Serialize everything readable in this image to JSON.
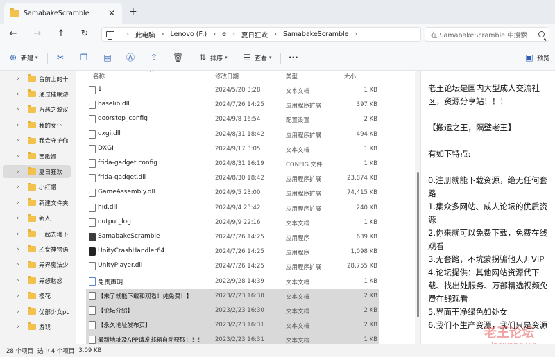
{
  "window": {
    "tab_title": "SamabakeScramble",
    "tab_close": "✕",
    "tab_add": "+"
  },
  "nav": {
    "back": "←",
    "forward": "→",
    "up": "↑",
    "refresh": "↻"
  },
  "breadcrumb": [
    "此电脑",
    "Lenovo (F:)",
    "e",
    "夏日狂欢",
    "SamabakeScramble"
  ],
  "search": {
    "placeholder": "在 SamabakeScramble 中搜索"
  },
  "toolbar": {
    "new_label": "新建",
    "sort_label": "排序",
    "view_label": "查看",
    "more_label": "···",
    "preview_label": "预览"
  },
  "sidebar": {
    "items": [
      {
        "label": "台前上的十"
      },
      {
        "label": "通过催眠游"
      },
      {
        "label": "万恶之源汉"
      },
      {
        "label": "我的女仆"
      },
      {
        "label": "我会守护你"
      },
      {
        "label": "西歌娜"
      },
      {
        "label": "夏日狂欢",
        "selected": true
      },
      {
        "label": "小红帽"
      },
      {
        "label": "新建文件夹"
      },
      {
        "label": "新人"
      },
      {
        "label": "一起去地下"
      },
      {
        "label": "乙女神物语"
      },
      {
        "label": "异界魔法少"
      },
      {
        "label": "异想魅惑"
      },
      {
        "label": "樱花"
      },
      {
        "label": "优部少女pc"
      },
      {
        "label": "游戏"
      }
    ]
  },
  "columns": {
    "name": "名称",
    "date": "修改日期",
    "type": "类型",
    "size": "大小"
  },
  "files": [
    {
      "name": "1",
      "date": "2024/5/20 3:28",
      "type": "文本文档",
      "size": "1 KB",
      "icon": "file-icon"
    },
    {
      "name": "baselib.dll",
      "date": "2024/7/26 14:25",
      "type": "应用程序扩展",
      "size": "397 KB",
      "icon": "dll-icon"
    },
    {
      "name": "doorstop_config",
      "date": "2024/9/8 16:54",
      "type": "配置设置",
      "size": "2 KB",
      "icon": "config-icon"
    },
    {
      "name": "dxgi.dll",
      "date": "2024/8/31 18:42",
      "type": "应用程序扩展",
      "size": "494 KB",
      "icon": "dll-icon"
    },
    {
      "name": "DXGI",
      "date": "2024/9/17 3:05",
      "type": "文本文档",
      "size": "1 KB",
      "icon": "file-icon"
    },
    {
      "name": "frida-gadget.config",
      "date": "2024/8/31 16:19",
      "type": "CONFIG 文件",
      "size": "1 KB",
      "icon": "file-icon"
    },
    {
      "name": "frida-gadget.dll",
      "date": "2024/8/30 18:42",
      "type": "应用程序扩展",
      "size": "23,874 KB",
      "icon": "dll-icon"
    },
    {
      "name": "GameAssembly.dll",
      "date": "2024/9/5 23:00",
      "type": "应用程序扩展",
      "size": "74,415 KB",
      "icon": "dll-icon"
    },
    {
      "name": "hid.dll",
      "date": "2024/9/4 23:42",
      "type": "应用程序扩展",
      "size": "240 KB",
      "icon": "dll-icon"
    },
    {
      "name": "output_log",
      "date": "2024/9/9 22:16",
      "type": "文本文档",
      "size": "1 KB",
      "icon": "file-icon"
    },
    {
      "name": "SamabakeScramble",
      "date": "2024/7/26 14:25",
      "type": "应用程序",
      "size": "639 KB",
      "icon": "exe-icon"
    },
    {
      "name": "UnityCrashHandler64",
      "date": "2024/7/26 14:25",
      "type": "应用程序",
      "size": "1,098 KB",
      "icon": "unity-icon"
    },
    {
      "name": "UnityPlayer.dll",
      "date": "2024/7/26 14:25",
      "type": "应用程序扩展",
      "size": "28,755 KB",
      "icon": "dll-icon"
    },
    {
      "name": "免责声明",
      "date": "2022/9/28 14:39",
      "type": "文本文档",
      "size": "1 KB",
      "icon": "text-selected-icon",
      "selected": true
    },
    {
      "name": "【来了就能下载和观看！纯免费！】",
      "date": "2023/2/23 16:30",
      "type": "文本文档",
      "size": "2 KB",
      "icon": "file-icon",
      "selected": true
    },
    {
      "name": "【论坛介绍】",
      "date": "2023/2/23 16:30",
      "type": "文本文档",
      "size": "2 KB",
      "icon": "file-icon",
      "selected": true
    },
    {
      "name": "【永久地址发布页】",
      "date": "2023/2/23 16:31",
      "type": "文本文档",
      "size": "2 KB",
      "icon": "file-icon",
      "selected": true
    },
    {
      "name": "最新地址及APP请发邮箱自动获取！！！",
      "date": "2023/2/23 16:31",
      "type": "文本文档",
      "size": "1 KB",
      "icon": "file-icon",
      "selected": true
    }
  ],
  "preview": {
    "paragraphs": [
      "老王论坛是国内大型成人交流社区，资源分享站！！！",
      "【搬运之王，隔壁老王】",
      "有如下特点:",
      "0.注册就能下载资源，绝无任何套路",
      "1.集众多网站、成人论坛的优质资源",
      "2.你来就可以免费下载，免费在线观看",
      "3.无套路，不坑蒙拐骗他人开VIP",
      "4.论坛提供：其他网站资源代下载、找出处服务、万部精选视频免费在线观看",
      "5.界面干净绿色如处女",
      "6.我们不生产资源，我们只是资源"
    ]
  },
  "status": {
    "count": "28 个项目",
    "selected": "选中 4 个项目",
    "size": "3.09 KB"
  },
  "watermark": {
    "main": "老王论坛",
    "sub": "laowang.vip"
  }
}
